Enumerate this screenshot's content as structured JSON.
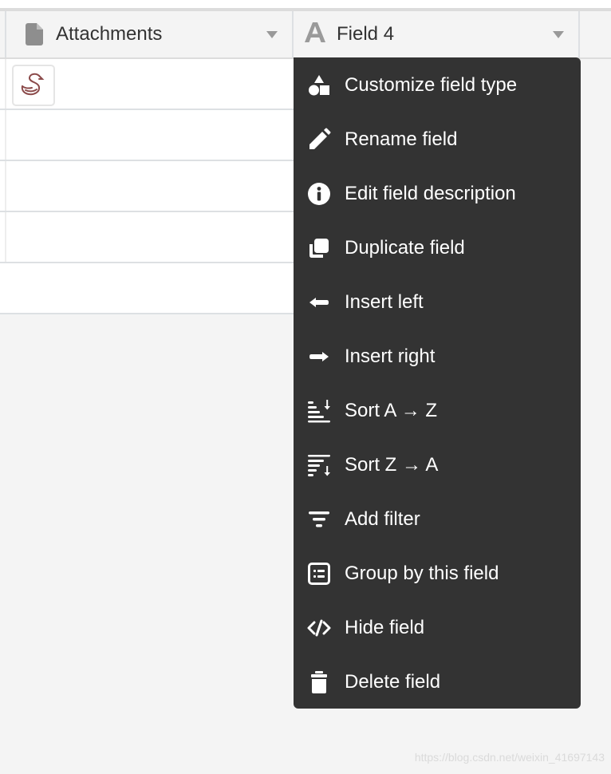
{
  "columns": [
    {
      "name": "Attachments",
      "icon": "file-icon"
    },
    {
      "name": "Field 4",
      "icon": "text-field-icon"
    }
  ],
  "rows": [
    {
      "attachment": "swan-thumbnail"
    },
    {
      "attachment": ""
    },
    {
      "attachment": ""
    },
    {
      "attachment": ""
    },
    {
      "attachment": ""
    }
  ],
  "menu": {
    "items": [
      {
        "label": "Customize field type",
        "icon": "shapes-icon"
      },
      {
        "label": "Rename field",
        "icon": "pencil-icon"
      },
      {
        "label": "Edit field description",
        "icon": "info-icon"
      },
      {
        "label": "Duplicate field",
        "icon": "duplicate-icon"
      },
      {
        "label": "Insert left",
        "icon": "arrow-left-icon"
      },
      {
        "label": "Insert right",
        "icon": "arrow-right-icon"
      },
      {
        "label": "Sort A → Z",
        "icon": "sort-ascending-icon"
      },
      {
        "label": "Sort Z → A",
        "icon": "sort-descending-icon"
      },
      {
        "label": "Add filter",
        "icon": "filter-icon"
      },
      {
        "label": "Group by this field",
        "icon": "group-icon"
      },
      {
        "label": "Hide field",
        "icon": "hide-icon"
      },
      {
        "label": "Delete field",
        "icon": "trash-icon"
      }
    ]
  },
  "colors": {
    "menu_bg": "#333333",
    "header_bg": "#f4f4f4",
    "swan": "#8b4a4a"
  },
  "watermark": "https://blog.csdn.net/weixin_41697143"
}
